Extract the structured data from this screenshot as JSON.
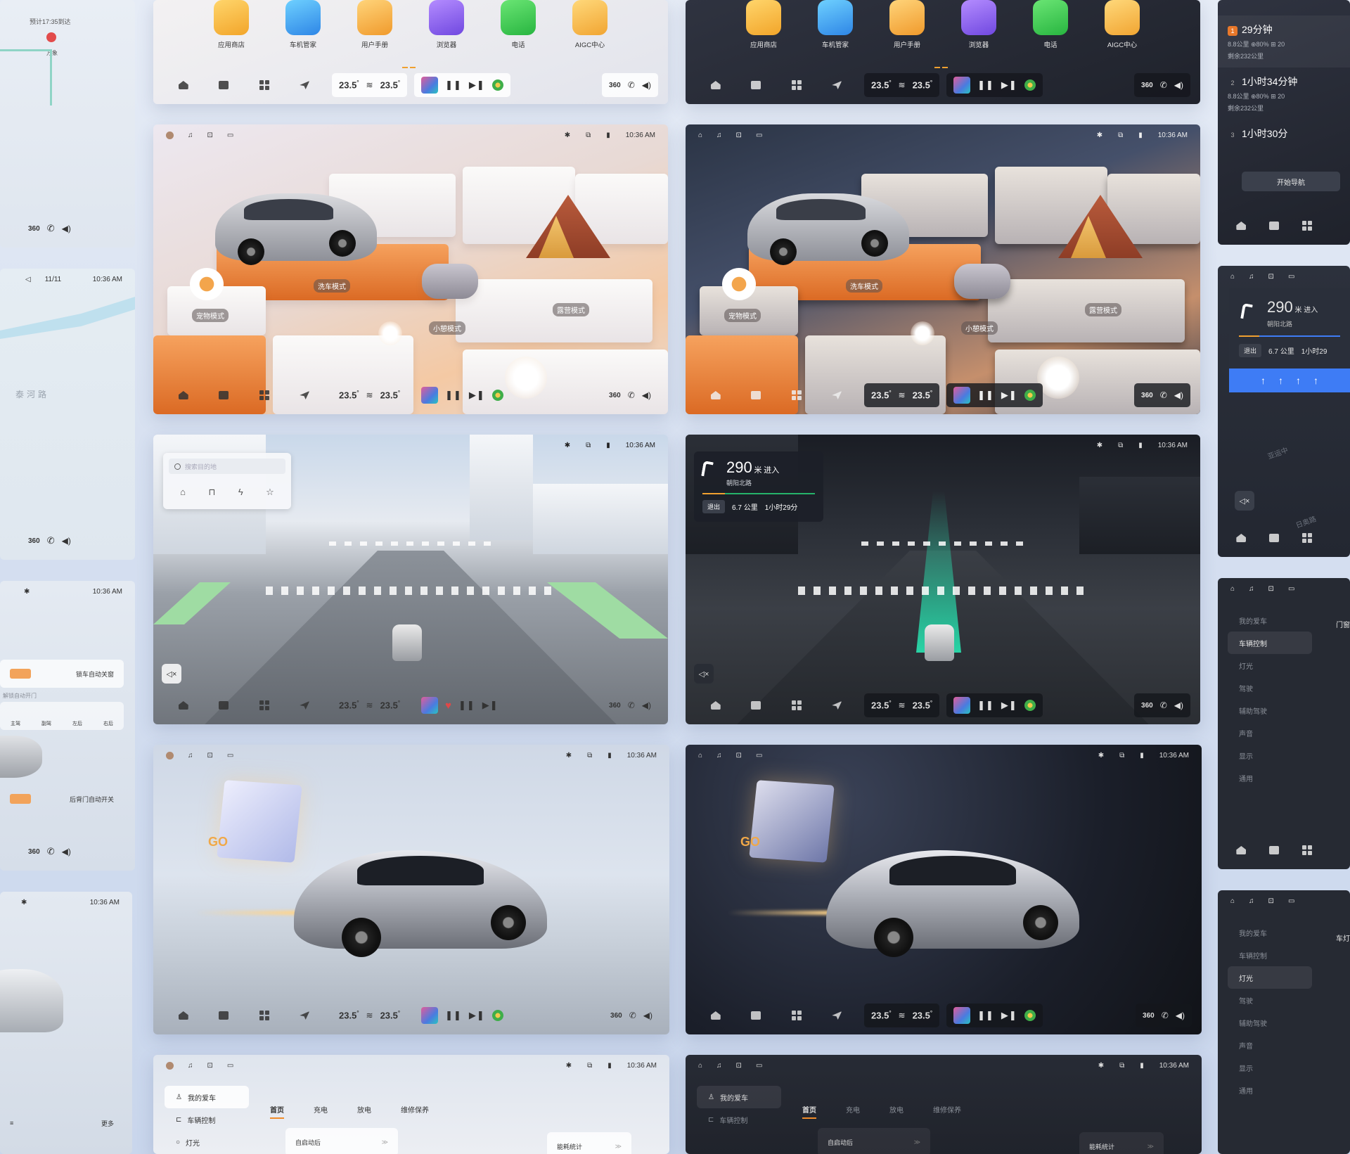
{
  "dock": {
    "temp_left": "23.5",
    "temp_right": "23.5",
    "deg": "°",
    "cam360": "360"
  },
  "apps": [
    {
      "key": "appstore",
      "label": "应用商店"
    },
    {
      "key": "carmgr",
      "label": "车机管家"
    },
    {
      "key": "manual",
      "label": "用户手册"
    },
    {
      "key": "browser",
      "label": "浏览器"
    },
    {
      "key": "phone",
      "label": "电话"
    },
    {
      "key": "aigc",
      "label": "AIGC中心"
    }
  ],
  "status": {
    "time": "10:36 AM",
    "date": "11/11"
  },
  "modes": {
    "wash": "洗车模式",
    "pet": "宠物模式",
    "rest": "小憩模式",
    "camp": "露营模式"
  },
  "search": {
    "placeholder": "搜索目的地"
  },
  "nav": {
    "distance": "290",
    "unit": "米",
    "action": "进入",
    "road": "朝阳北路",
    "exit": "退出",
    "remain": "6.7",
    "remain_unit": "公里",
    "eta": "1小时29分"
  },
  "hero": {
    "go": "GO"
  },
  "settings": {
    "side": [
      {
        "label": "我的爱车"
      },
      {
        "label": "车辆控制"
      },
      {
        "label": "灯光"
      },
      {
        "label": "驾驶"
      },
      {
        "label": "辅助驾驶"
      },
      {
        "label": "声音"
      },
      {
        "label": "显示"
      },
      {
        "label": "通用"
      }
    ],
    "tabs": [
      "首页",
      "充电",
      "放电",
      "维修保养"
    ],
    "card1": "自启动后",
    "card2": "能耗统计"
  },
  "left_col": {
    "arrive": "预计17:35到达",
    "dest": "万象",
    "river": "泰河路",
    "lock_label": "锁车自动关窗",
    "sub_label": "解锁自动开门",
    "tailgate": "后背门自动开关",
    "more": "更多",
    "seat_labels": [
      "主驾",
      "副驾",
      "左后",
      "右后"
    ]
  },
  "right_col": {
    "routes": [
      {
        "n": "1",
        "time": "29分钟",
        "meta": "8.8公里  ⊕80%  ⊞ 20",
        "left": "剩余232公里"
      },
      {
        "n": "2",
        "time": "1小时34分钟",
        "meta": "8.8公里  ⊕80%  ⊞ 20",
        "left": "剩余232公里"
      },
      {
        "n": "3",
        "time": "1小时30分",
        "meta": "",
        "left": ""
      }
    ],
    "start": "开始导航",
    "nav_dist": "290",
    "nav_unit": "米",
    "nav_act": "进入",
    "nav_road": "朝阳北路",
    "nav_exit": "退出",
    "nav_remain": "6.7",
    "nav_remain_unit": "公里",
    "nav_eta": "1小时29",
    "map_road": "亚运中",
    "map_road2": "日奥路",
    "set_items": [
      "我的爱车",
      "车辆控制",
      "灯光",
      "驾驶",
      "辅助驾驶",
      "声音",
      "显示",
      "通用"
    ],
    "door": "门窗",
    "lamp": "车灯"
  }
}
